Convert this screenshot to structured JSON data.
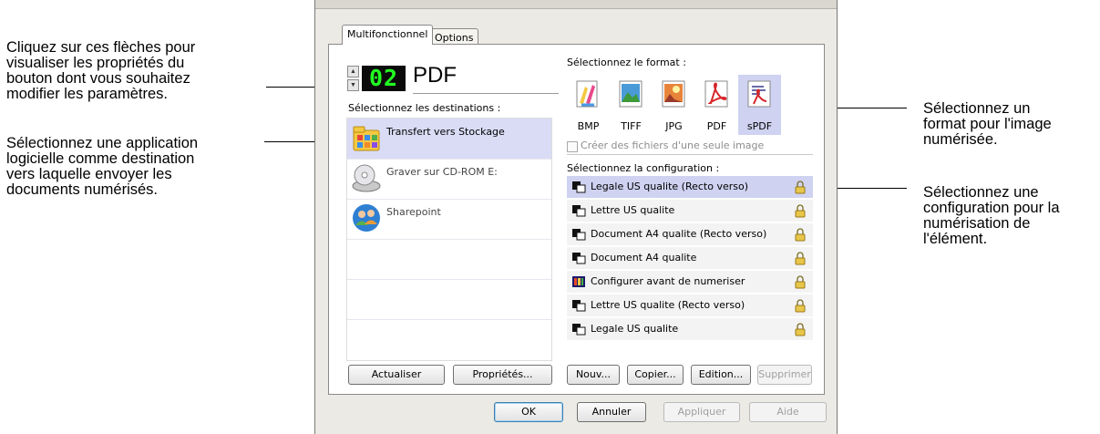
{
  "callouts": {
    "arrows": [
      "Cliquez sur ces flèches pour",
      "visualiser les propriétés du",
      "bouton dont vous souhaitez",
      "modifier les paramètres."
    ],
    "destination": [
      "Sélectionnez une application",
      "logicielle comme destination",
      "vers laquelle envoyer les",
      "documents numérisés."
    ],
    "format": [
      "Sélectionnez un",
      "format pour l'image",
      "numérisée."
    ],
    "configuration": [
      "Sélectionnez une",
      "configuration pour la",
      "numérisation de",
      "l'élément."
    ]
  },
  "tabs": [
    {
      "label": "Multifonctionnel",
      "active": true
    },
    {
      "label": "Options",
      "active": false
    }
  ],
  "profile": {
    "number": "02",
    "name": "PDF"
  },
  "destinations": {
    "heading": "Sélectionnez les destinations :",
    "items": [
      {
        "label": "Transfert vers Stockage",
        "icon": "storage-folder-icon",
        "selected": true
      },
      {
        "label": "Graver sur CD-ROM  E:",
        "icon": "cd-drive-icon",
        "selected": false
      },
      {
        "label": "Sharepoint",
        "icon": "sharepoint-people-icon",
        "selected": false
      }
    ]
  },
  "formats": {
    "heading": "Sélectionnez le format :",
    "items": [
      {
        "label": "BMP",
        "icon": "bmp-paint-icon",
        "selected": false
      },
      {
        "label": "TIFF",
        "icon": "tiff-image-icon",
        "selected": false
      },
      {
        "label": "JPG",
        "icon": "jpg-image-icon",
        "selected": false
      },
      {
        "label": "PDF",
        "icon": "pdf-acrobat-icon",
        "selected": false
      },
      {
        "label": "sPDF",
        "icon": "spdf-searchable-icon",
        "selected": true
      }
    ],
    "single_image_checkbox": {
      "label": "Créer des fichiers d'une seule image",
      "checked": false,
      "enabled": false
    }
  },
  "configurations": {
    "heading": "Sélectionnez la configuration :",
    "items": [
      {
        "label": "Legale US qualite (Recto verso)",
        "icon": "bw-scan-icon",
        "selected": true
      },
      {
        "label": "Lettre US qualite",
        "icon": "bw-scan-icon",
        "selected": false
      },
      {
        "label": "Document A4 qualite (Recto verso)",
        "icon": "bw-scan-icon",
        "selected": false
      },
      {
        "label": "Document A4 qualite",
        "icon": "bw-scan-icon",
        "selected": false
      },
      {
        "label": "Configurer avant de numeriser",
        "icon": "color-configure-icon",
        "selected": false
      },
      {
        "label": "Lettre US qualite (Recto verso)",
        "icon": "bw-scan-icon",
        "selected": false
      },
      {
        "label": "Legale US qualite",
        "icon": "bw-scan-icon",
        "selected": false
      }
    ]
  },
  "buttons": {
    "refresh": "Actualiser",
    "properties": "Propriétés...",
    "new": "Nouv...",
    "copy": "Copier...",
    "edit": "Edition...",
    "delete": "Supprimer",
    "ok": "OK",
    "cancel": "Annuler",
    "apply": "Appliquer",
    "help": "Aide"
  },
  "colors": {
    "selection": "#cfd3f1",
    "lcd_digits": "#22ff22",
    "lock": "#e8c64a"
  }
}
